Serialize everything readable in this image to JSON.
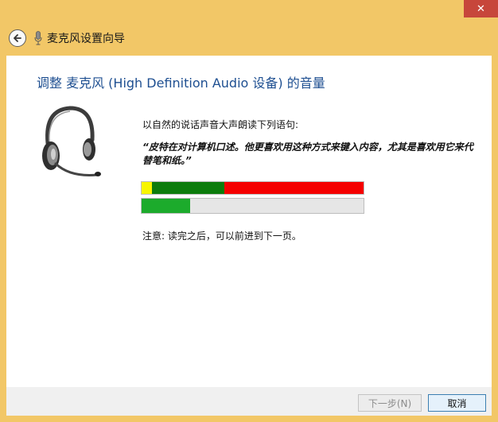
{
  "window": {
    "close_glyph": "✕"
  },
  "header": {
    "title": "麦克风设置向导",
    "back_icon": "back-arrow-icon",
    "mic_icon": "microphone-icon"
  },
  "main": {
    "heading": "调整 麦克风 (High Definition Audio 设备) 的音量",
    "prompt": "以自然的说话声音大声朗读下列语句:",
    "quote": "“皮特在对计算机口述。他更喜欢用这种方式来键入内容，尤其是喜欢用它来代替笔和纸。”",
    "level_meter": {
      "peak_fraction": 0.22
    },
    "note": "注意: 读完之后，可以前进到下一页。",
    "headset_icon": "headset-icon"
  },
  "footer": {
    "next_label": "下一步(N)",
    "cancel_label": "取消"
  },
  "colors": {
    "title_bar": "#f2c767",
    "heading": "#1e4f91",
    "meter_yellow": "#f7f500",
    "meter_green": "#0c7c0c",
    "meter_red": "#f50000",
    "meter_fill": "#1cab2c",
    "close": "#c7463b"
  }
}
